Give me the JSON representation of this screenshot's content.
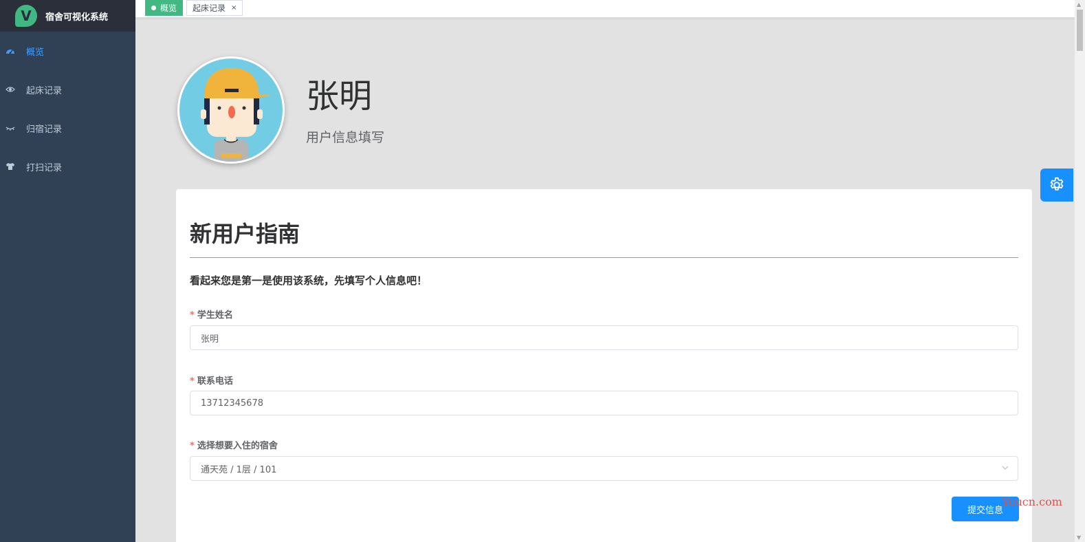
{
  "app": {
    "title": "宿舍可视化系统",
    "logo_letter": "V",
    "brand_color": "#41b883"
  },
  "sidebar": {
    "items": [
      {
        "label": "概览",
        "icon": "dashboard-icon",
        "active": true
      },
      {
        "label": "起床记录",
        "icon": "eye-icon",
        "active": false
      },
      {
        "label": "归宿记录",
        "icon": "eye-closed-icon",
        "active": false
      },
      {
        "label": "打扫记录",
        "icon": "shirt-icon",
        "active": false
      }
    ]
  },
  "tags": {
    "active": {
      "label": "概览"
    },
    "normal": {
      "label": "起床记录",
      "close": "×"
    }
  },
  "profile": {
    "name": "张明",
    "subtitle": "用户信息填写"
  },
  "card": {
    "title": "新用户指南",
    "subtitle": "看起来您是第一是使用该系统，先填写个人信息吧！",
    "fields": [
      {
        "label": "学生姓名",
        "value": "张明",
        "required": true
      },
      {
        "label": "联系电话",
        "value": "13712345678",
        "required": true
      },
      {
        "label": "选择想要入住的宿舍",
        "value": "通天苑 / 1层 / 101",
        "required": true,
        "type": "select"
      }
    ],
    "submit_label": "提交信息"
  },
  "watermark": "Yuucn.com",
  "colors": {
    "sidebar_bg": "#304156",
    "primary": "#1890ff",
    "active_tag": "#42b983",
    "required": "#f56c6c"
  }
}
